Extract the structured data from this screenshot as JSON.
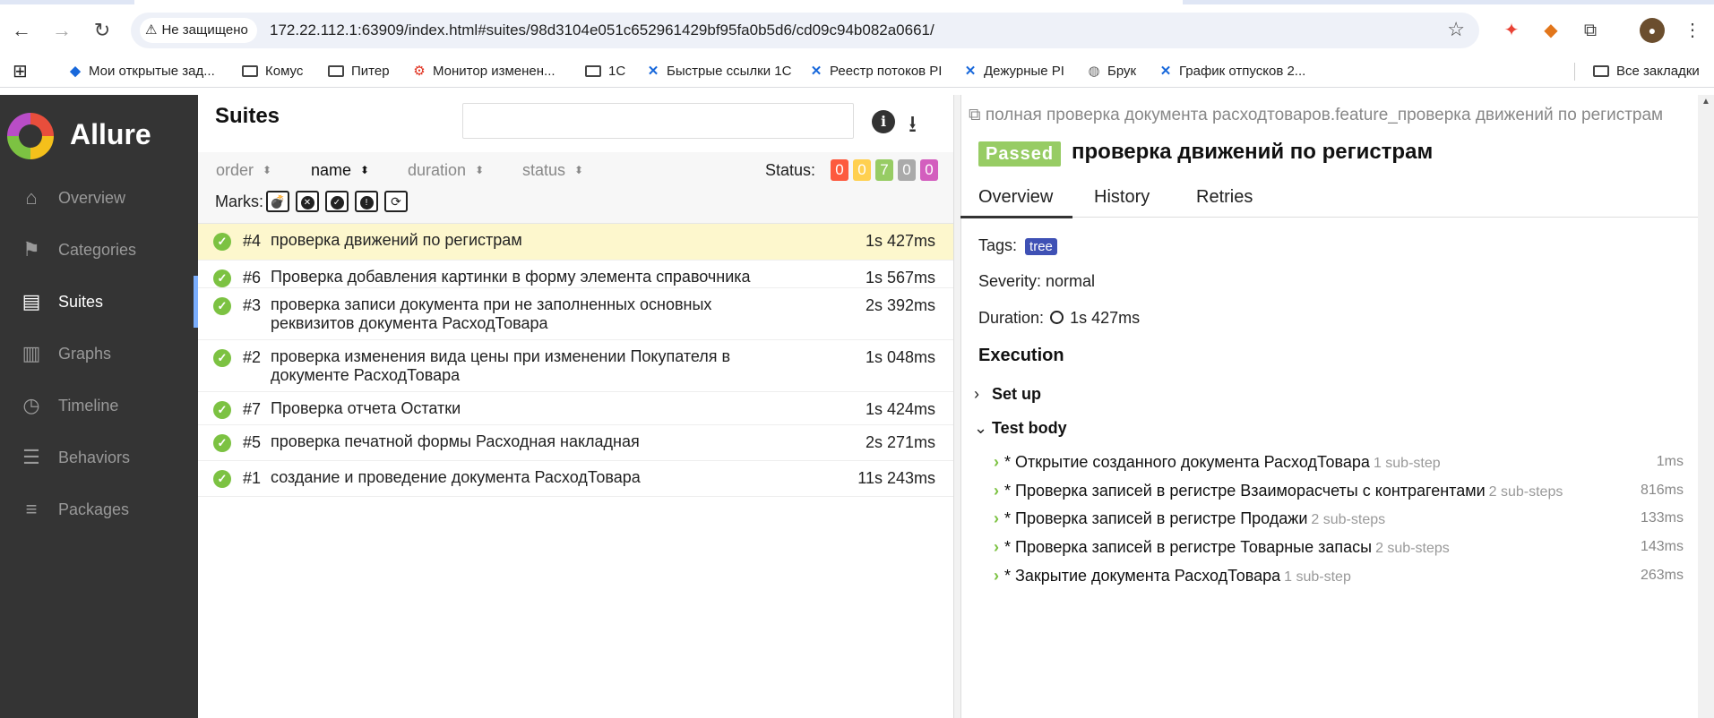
{
  "browser": {
    "security_label": "Не защищено",
    "url": "172.22.112.1:63909/index.html#suites/98d3104e051c652961429bf95fa0b5d6/cd09c94b082a0661/",
    "bookmarks": [
      {
        "label": "Мои открытые зад...",
        "icon": "jira-diamond-icon"
      },
      {
        "label": "Комус",
        "icon": "folder-icon"
      },
      {
        "label": "Питер",
        "icon": "folder-icon"
      },
      {
        "label": "Монитор изменен...",
        "icon": "monitor-icon"
      },
      {
        "label": "1С",
        "icon": "folder-icon"
      },
      {
        "label": "Быстрые ссылки 1С",
        "icon": "confluence-icon"
      },
      {
        "label": "Реестр потоков PI",
        "icon": "confluence-icon"
      },
      {
        "label": "Дежурные PI",
        "icon": "confluence-icon"
      },
      {
        "label": "Брук",
        "icon": "globe-icon"
      },
      {
        "label": "График отпусков 2...",
        "icon": "confluence-icon"
      }
    ],
    "all_bookmarks": "Все закладки"
  },
  "sidebar": {
    "brand": "Allure",
    "items": [
      {
        "label": "Overview",
        "icon": "home-icon"
      },
      {
        "label": "Categories",
        "icon": "flag-icon"
      },
      {
        "label": "Suites",
        "icon": "briefcase-icon"
      },
      {
        "label": "Graphs",
        "icon": "bar-chart-icon"
      },
      {
        "label": "Timeline",
        "icon": "clock-icon"
      },
      {
        "label": "Behaviors",
        "icon": "list-icon"
      },
      {
        "label": "Packages",
        "icon": "align-left-icon"
      }
    ],
    "active": "Suites"
  },
  "suites": {
    "title": "Suites",
    "search_placeholder": "",
    "sort": {
      "order": "order",
      "name": "name",
      "duration": "duration",
      "status": "status"
    },
    "status_label": "Status:",
    "status_counts": [
      {
        "value": "0",
        "color": "#fd5a3e"
      },
      {
        "value": "0",
        "color": "#ffd050"
      },
      {
        "value": "7",
        "color": "#97cc64"
      },
      {
        "value": "0",
        "color": "#aaaaaa"
      },
      {
        "value": "0",
        "color": "#d35ebe"
      }
    ],
    "marks_label": "Marks:",
    "rows": [
      {
        "num": "#4",
        "name": "проверка движений по регистрам",
        "duration": "1s 427ms"
      },
      {
        "num": "#6",
        "name": "Проверка добавления картинки в форму элемента справочника Товары",
        "duration": "1s 567ms"
      },
      {
        "num": "#3",
        "name": "проверка записи документа при не заполненных основных реквизитов документа РасходТовара",
        "duration": "2s 392ms"
      },
      {
        "num": "#2",
        "name": "проверка изменения вида цены при изменении Покупателя в документе РасходТовара",
        "duration": "1s 048ms"
      },
      {
        "num": "#7",
        "name": "Проверка отчета Остатки",
        "duration": "1s 424ms"
      },
      {
        "num": "#5",
        "name": "проверка печатной формы Расходная накладная",
        "duration": "2s 271ms"
      },
      {
        "num": "#1",
        "name": "создание и проведение документа РасходТовара",
        "duration": "11s 243ms"
      }
    ]
  },
  "detail": {
    "breadcrumb": "полная проверка документа расходтоваров.feature_проверка движений по регистрам",
    "status": "Passed",
    "title": "проверка движений по регистрам",
    "tabs": [
      "Overview",
      "History",
      "Retries"
    ],
    "tags_label": "Tags:",
    "tag": "tree",
    "severity": "Severity: normal",
    "duration_label": "Duration:",
    "duration": "1s 427ms",
    "execution": "Execution",
    "setup": "Set up",
    "test_body": "Test body",
    "steps": [
      {
        "name": "* Открытие созданного документа РасходТовара",
        "sub": "1 sub-step",
        "dur": "1ms"
      },
      {
        "name": "* Проверка записей в регистре Взаиморасчеты с контрагентами",
        "sub": "2 sub-steps",
        "dur": "816ms"
      },
      {
        "name": "* Проверка записей в регистре Продажи",
        "sub": "2 sub-steps",
        "dur": "133ms"
      },
      {
        "name": "* Проверка записей в регистре Товарные запасы",
        "sub": "2 sub-steps",
        "dur": "143ms"
      },
      {
        "name": "* Закрытие документа РасходТовара",
        "sub": "1 sub-step",
        "dur": "263ms"
      }
    ]
  }
}
